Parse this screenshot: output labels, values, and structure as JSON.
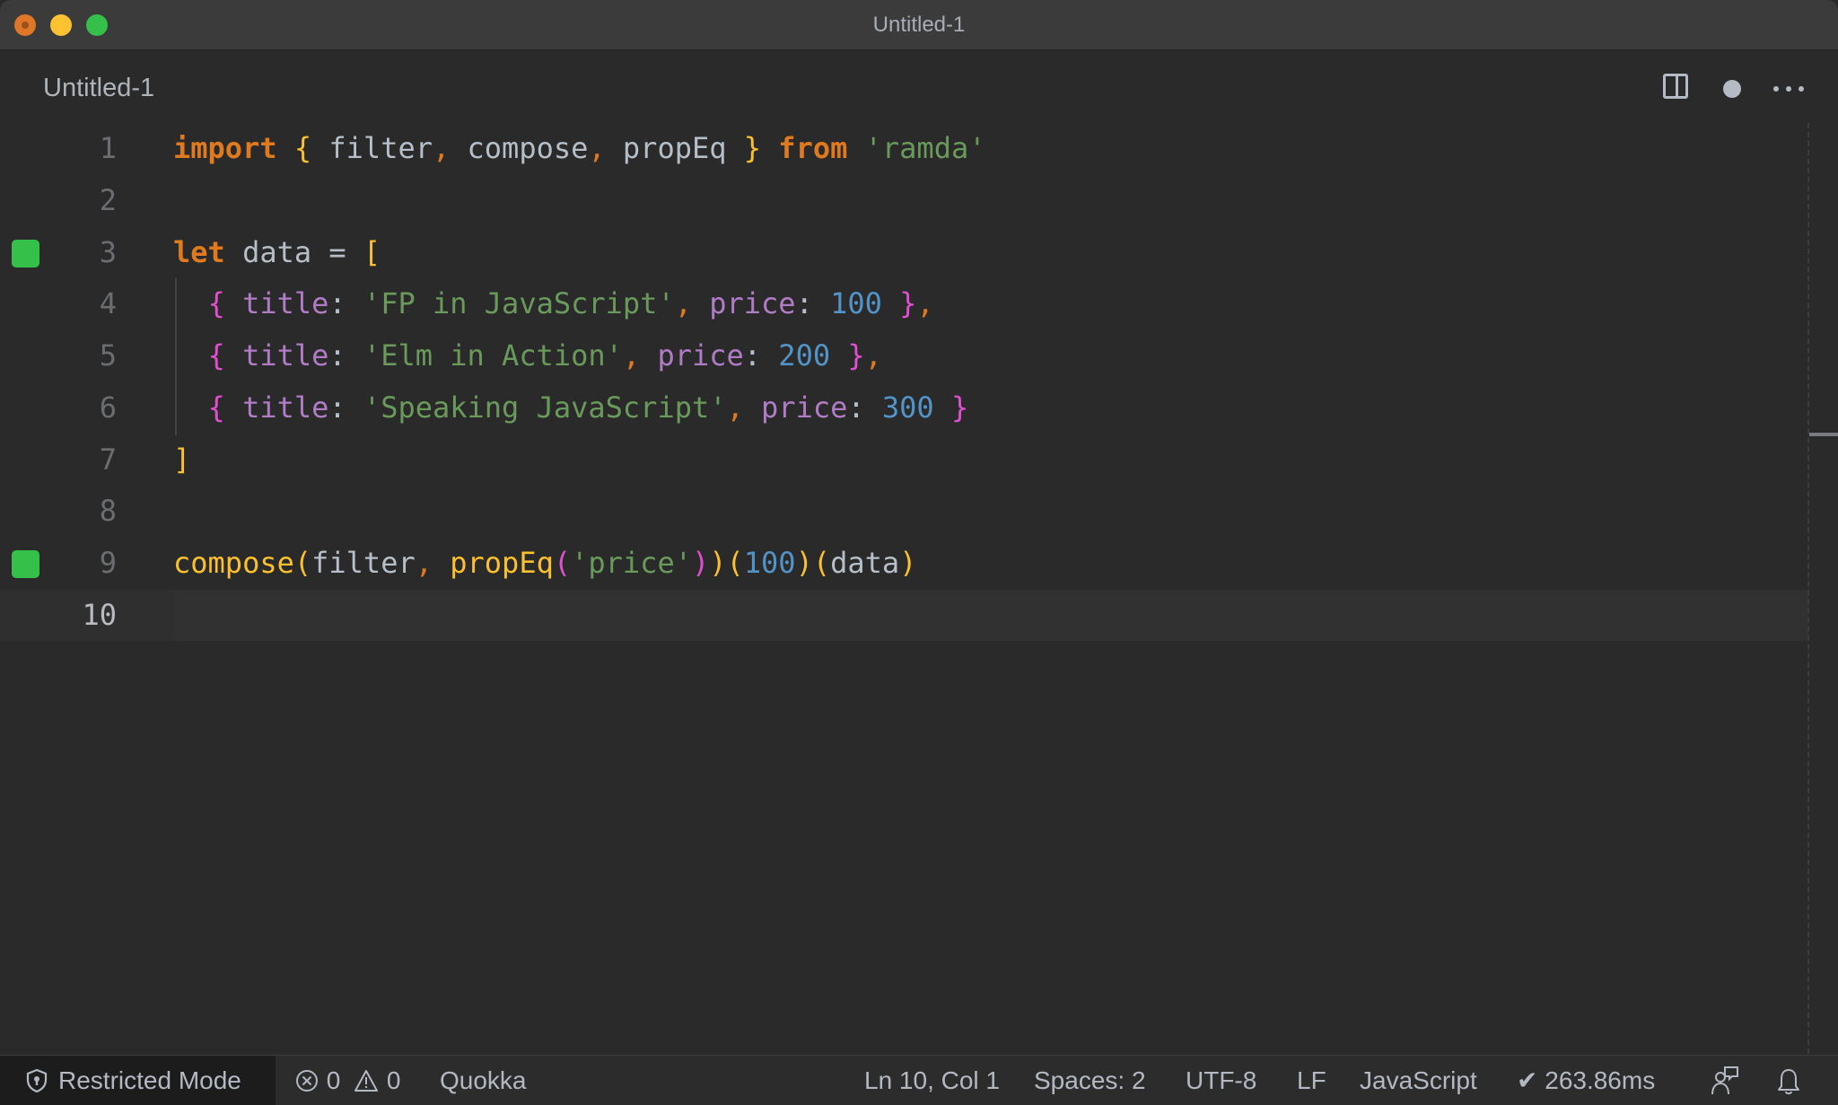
{
  "window": {
    "title": "Untitled-1",
    "traffic_lights": [
      "close",
      "minimize",
      "maximize"
    ]
  },
  "tab": {
    "label": "Untitled-1",
    "actions": [
      "split-editor-icon",
      "unsaved-dot-icon",
      "more-actions-icon"
    ]
  },
  "editor": {
    "lines": [
      {
        "number": "1"
      },
      {
        "number": "2"
      },
      {
        "number": "3",
        "marker": true
      },
      {
        "number": "4"
      },
      {
        "number": "5"
      },
      {
        "number": "6"
      },
      {
        "number": "7"
      },
      {
        "number": "8"
      },
      {
        "number": "9",
        "marker": true
      },
      {
        "number": "10",
        "current": true
      }
    ],
    "tokens": {
      "l1": [
        [
          "kw",
          "import"
        ],
        [
          "op",
          " "
        ],
        [
          "br-y",
          "{"
        ],
        [
          "id",
          " filter"
        ],
        [
          "punc-o",
          ","
        ],
        [
          "id",
          " compose"
        ],
        [
          "punc-o",
          ","
        ],
        [
          "id",
          " propEq "
        ],
        [
          "br-y",
          "}"
        ],
        [
          "op",
          " "
        ],
        [
          "kw",
          "from"
        ],
        [
          "op",
          " "
        ],
        [
          "str",
          "'ramda'"
        ]
      ],
      "l3": [
        [
          "kw",
          "let"
        ],
        [
          "id",
          " data = "
        ],
        [
          "br-y",
          "["
        ]
      ],
      "l4": [
        [
          "op",
          "  "
        ],
        [
          "br-p",
          "{"
        ],
        [
          "op",
          " "
        ],
        [
          "prop",
          "title"
        ],
        [
          "op",
          ": "
        ],
        [
          "str",
          "'FP in JavaScript'"
        ],
        [
          "punc-o",
          ","
        ],
        [
          "op",
          " "
        ],
        [
          "prop",
          "price"
        ],
        [
          "op",
          ": "
        ],
        [
          "num",
          "100"
        ],
        [
          "op",
          " "
        ],
        [
          "br-p",
          "}"
        ],
        [
          "punc-o",
          ","
        ]
      ],
      "l5": [
        [
          "op",
          "  "
        ],
        [
          "br-p",
          "{"
        ],
        [
          "op",
          " "
        ],
        [
          "prop",
          "title"
        ],
        [
          "op",
          ": "
        ],
        [
          "str",
          "'Elm in Action'"
        ],
        [
          "punc-o",
          ","
        ],
        [
          "op",
          " "
        ],
        [
          "prop",
          "price"
        ],
        [
          "op",
          ": "
        ],
        [
          "num",
          "200"
        ],
        [
          "op",
          " "
        ],
        [
          "br-p",
          "}"
        ],
        [
          "punc-o",
          ","
        ]
      ],
      "l6": [
        [
          "op",
          "  "
        ],
        [
          "br-p",
          "{"
        ],
        [
          "op",
          " "
        ],
        [
          "prop",
          "title"
        ],
        [
          "op",
          ": "
        ],
        [
          "str",
          "'Speaking JavaScript'"
        ],
        [
          "punc-o",
          ","
        ],
        [
          "op",
          " "
        ],
        [
          "prop",
          "price"
        ],
        [
          "op",
          ": "
        ],
        [
          "num",
          "300"
        ],
        [
          "op",
          " "
        ],
        [
          "br-p",
          "}"
        ]
      ],
      "l7": [
        [
          "br-y",
          "]"
        ]
      ],
      "l9": [
        [
          "fn",
          "compose"
        ],
        [
          "br-y",
          "("
        ],
        [
          "id",
          "filter"
        ],
        [
          "punc-o",
          ","
        ],
        [
          "op",
          " "
        ],
        [
          "fn",
          "propEq"
        ],
        [
          "br-p",
          "("
        ],
        [
          "str",
          "'price'"
        ],
        [
          "br-p",
          ")"
        ],
        [
          "br-y",
          ")"
        ],
        [
          "br-y",
          "("
        ],
        [
          "num",
          "100"
        ],
        [
          "br-y",
          ")"
        ],
        [
          "br-y",
          "("
        ],
        [
          "id",
          "data"
        ],
        [
          "br-y",
          ")"
        ]
      ]
    }
  },
  "statusbar": {
    "restricted_mode": "Restricted Mode",
    "errors": "0",
    "warnings": "0",
    "quokka": "Quokka",
    "cursor_position": "Ln 10, Col 1",
    "indentation": "Spaces: 2",
    "encoding": "UTF-8",
    "eol": "LF",
    "language": "JavaScript",
    "quokka_timing": "✔ 263.86ms"
  },
  "colors": {
    "keyword": "#e07a1f",
    "bracket_yellow": "#fbc02d",
    "bracket_pink": "#e04fd0",
    "string": "#6a9a5b",
    "property": "#b07cc6",
    "number": "#5294c8",
    "identifier": "#b6bec8",
    "marker_green": "#35c04a"
  }
}
